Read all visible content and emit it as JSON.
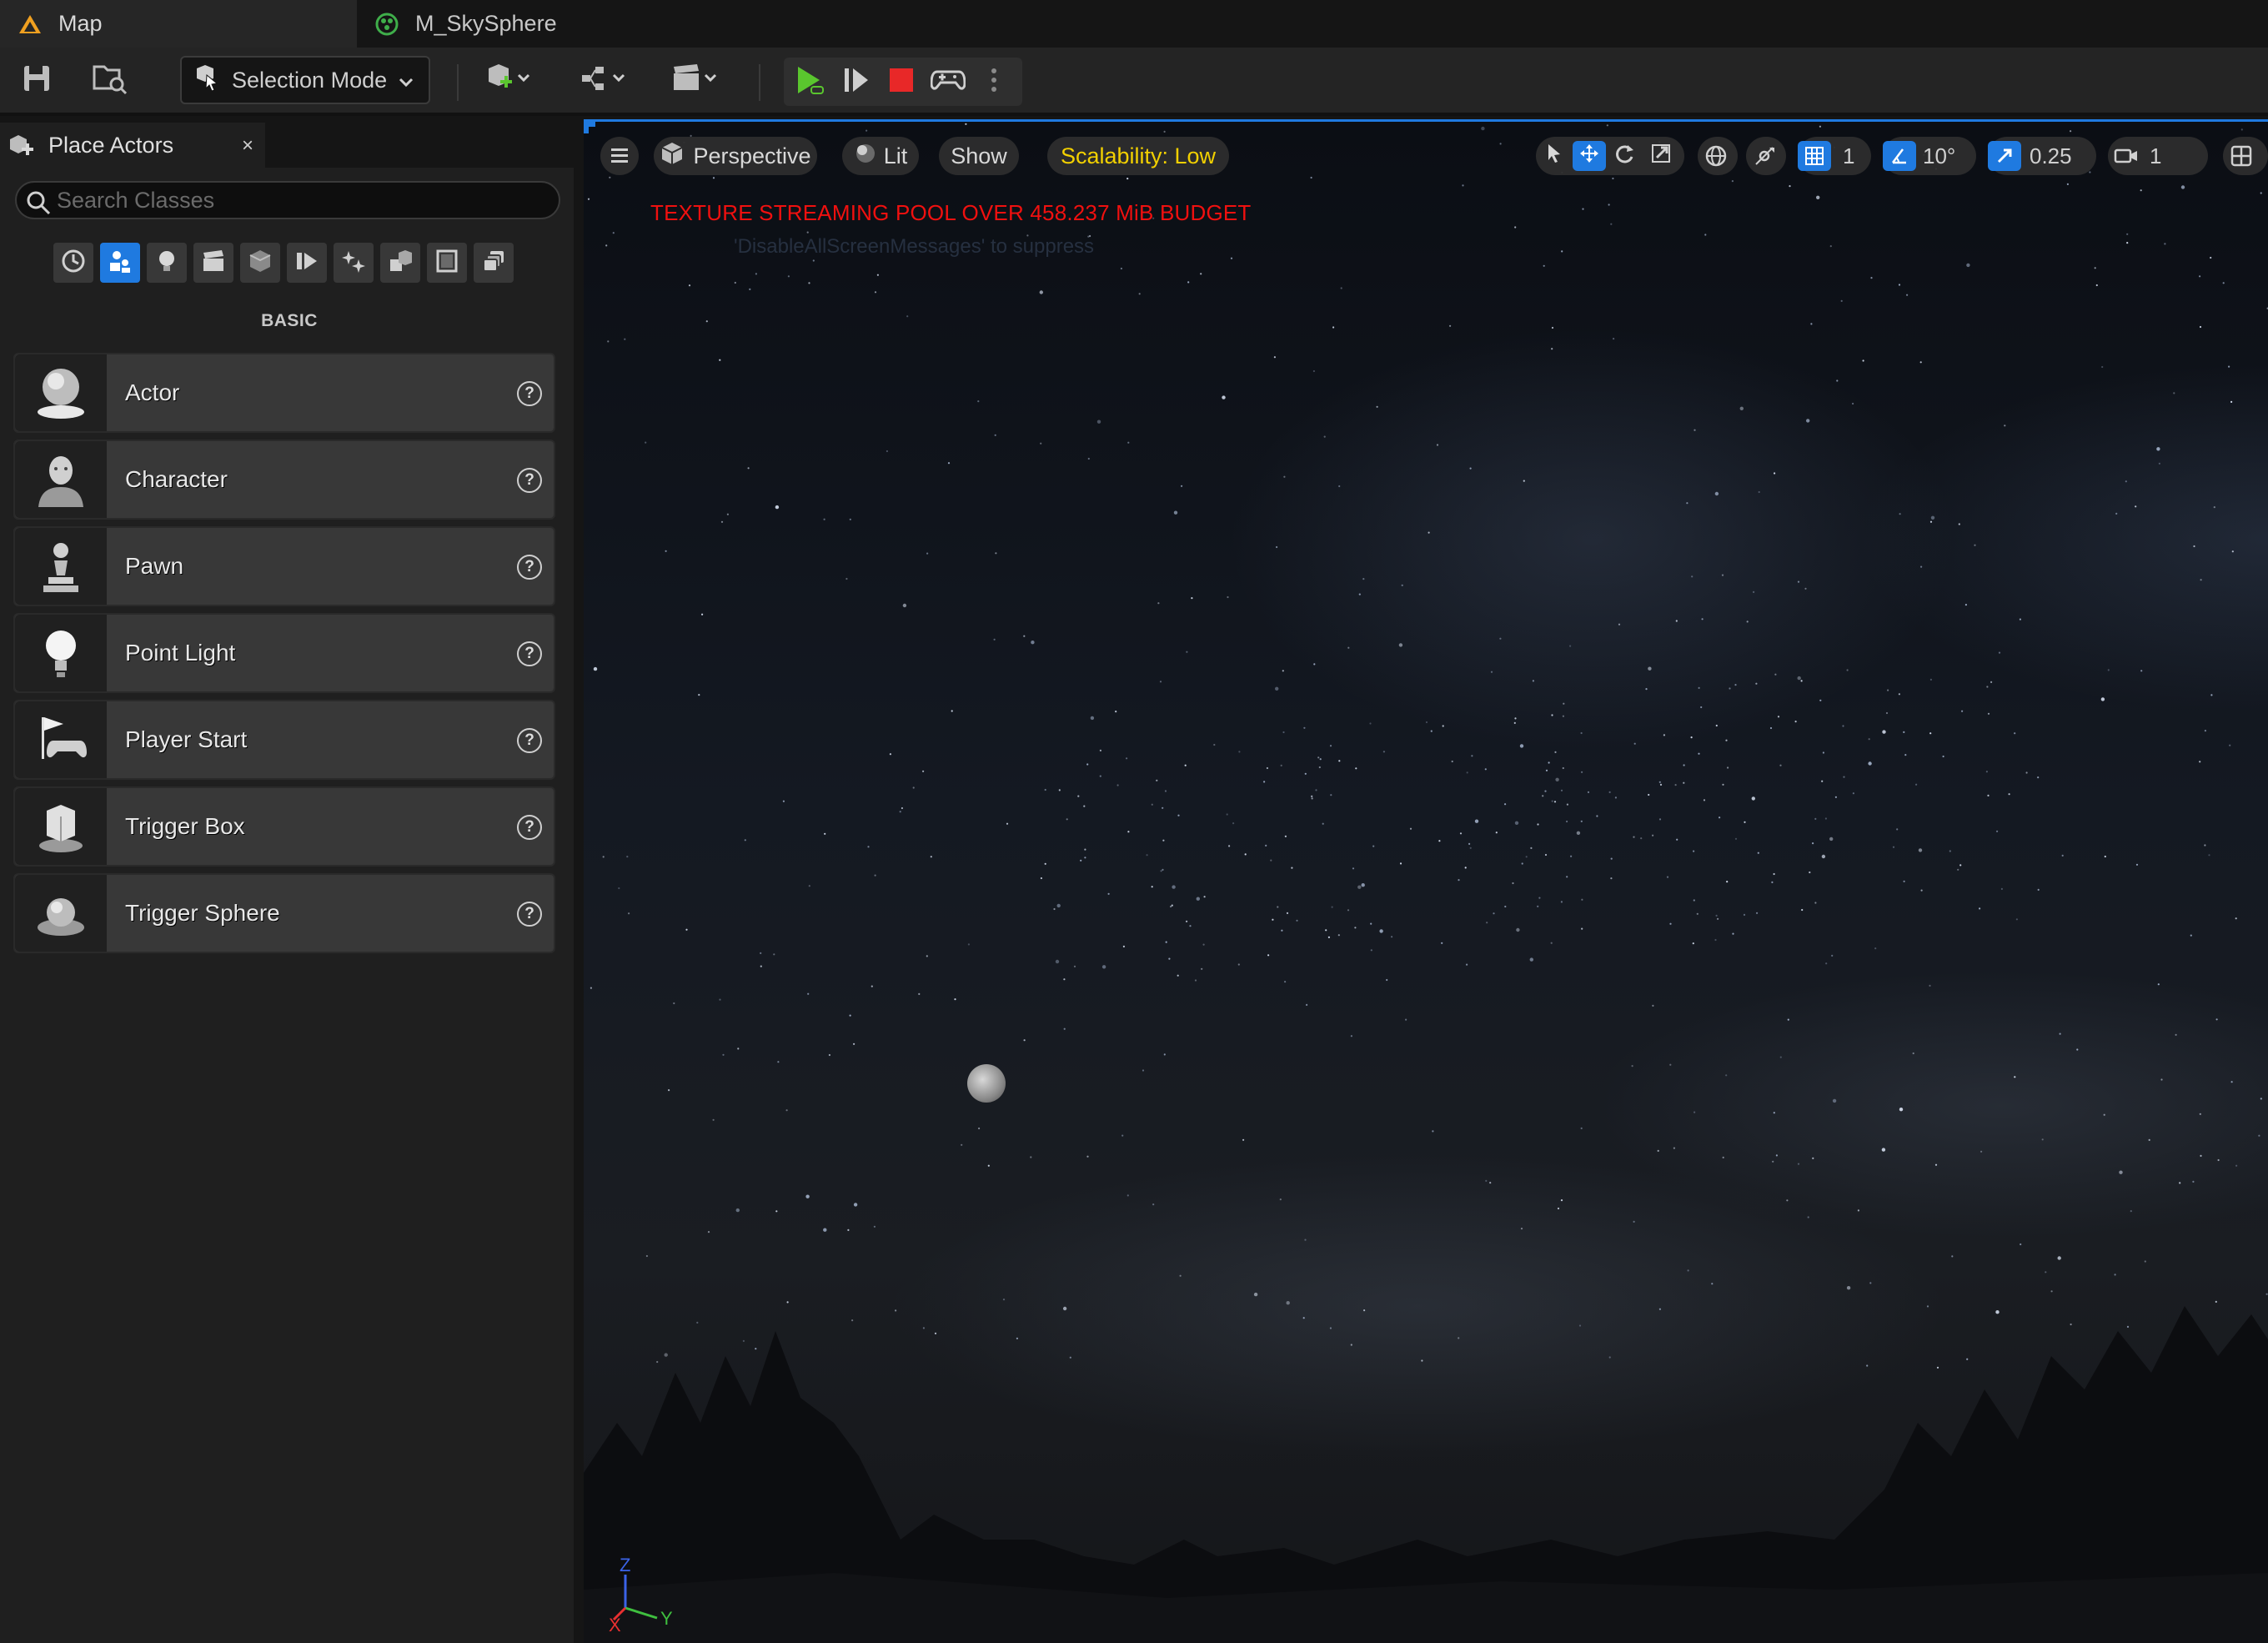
{
  "tabs": [
    {
      "label": "Map",
      "icon": "unreal-map-icon",
      "active": true
    },
    {
      "label": "M_SkySphere",
      "icon": "material-icon",
      "active": false
    }
  ],
  "toolbar": {
    "selection_mode": "Selection Mode"
  },
  "place_actors": {
    "title": "Place Actors",
    "close": "×",
    "search_placeholder": "Search Classes",
    "category_label": "BASIC",
    "items": [
      {
        "label": "Actor",
        "icon": "actor-sphere-icon"
      },
      {
        "label": "Character",
        "icon": "character-icon"
      },
      {
        "label": "Pawn",
        "icon": "pawn-icon"
      },
      {
        "label": "Point Light",
        "icon": "point-light-icon"
      },
      {
        "label": "Player Start",
        "icon": "player-start-icon"
      },
      {
        "label": "Trigger Box",
        "icon": "trigger-box-icon"
      },
      {
        "label": "Trigger Sphere",
        "icon": "trigger-sphere-icon"
      }
    ],
    "help_glyph": "?"
  },
  "viewport": {
    "view_mode": "Perspective",
    "lighting": "Lit",
    "show": "Show",
    "scalability": "Scalability: Low",
    "grid_snap": "1",
    "rotation_snap": "10°",
    "scale_snap": "0.25",
    "camera_speed": "1",
    "warning": "TEXTURE STREAMING POOL OVER 458.237 MiB BUDGET",
    "hint": "'DisableAllScreenMessages' to suppress",
    "axis_z": "Z",
    "axis_y": "Y",
    "axis_x": "X"
  },
  "colors": {
    "accent": "#1f7ae0",
    "warning": "#f0100f",
    "scalability": "#f2d000",
    "play_green": "#5ac62e",
    "stop_red": "#e82828"
  }
}
